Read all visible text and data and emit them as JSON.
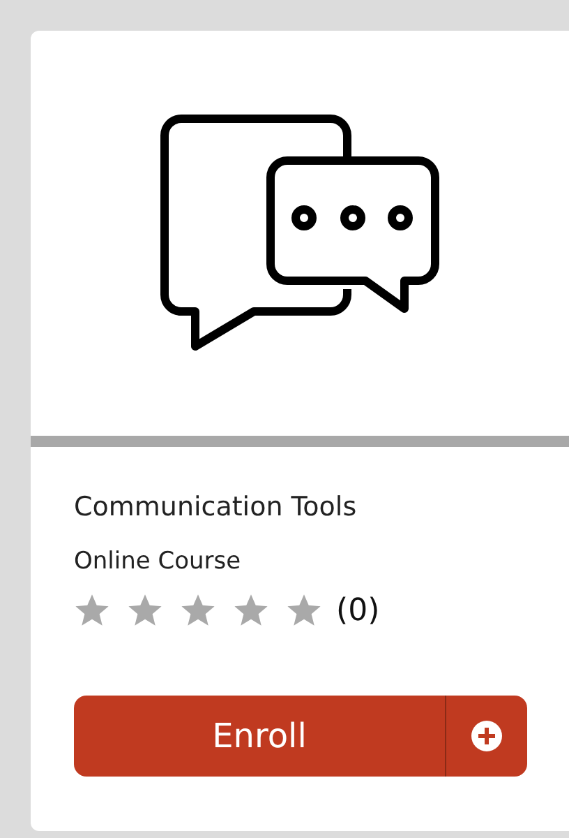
{
  "course": {
    "title": "Communication Tools",
    "type": "Online Course",
    "stars": 0,
    "rating_count": "(0)",
    "button": "Enroll"
  }
}
